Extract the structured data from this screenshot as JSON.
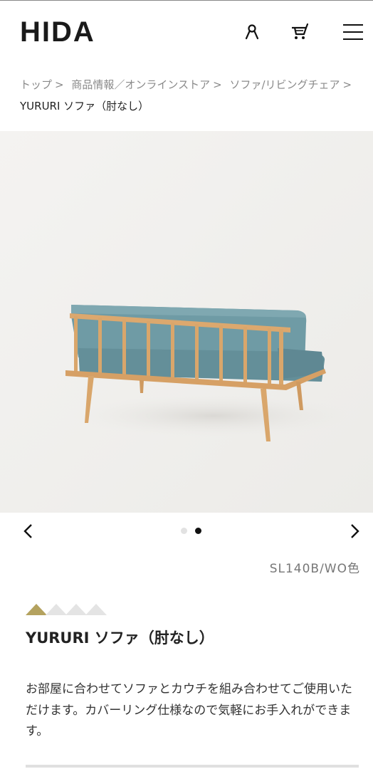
{
  "header": {
    "logo": "HIDA",
    "icons": [
      "user-icon",
      "cart-icon",
      "menu-icon"
    ]
  },
  "breadcrumb": {
    "items": [
      "トップ",
      "商品情報／オンラインストア",
      "ソファ/リビングチェア"
    ],
    "separator": ">",
    "current": "YURURI ソファ（肘なし）"
  },
  "gallery": {
    "image_alt": "sofa-photo",
    "slides": 2,
    "active_slide": 2
  },
  "product": {
    "variant": "SL140B/WO色",
    "rating": {
      "filled": 1,
      "total": 4
    },
    "name": "YURURI ソファ（肘なし）",
    "description": "お部屋に合わせてソファとカウチを組み合わせてご使用いただけます。カバーリング仕様なので気軽にお手入れができます。"
  },
  "colors": {
    "accent": "#b4a25f",
    "fabric": "#6f9ba5",
    "wood": "#d9a66b",
    "background": "#f1f0ee"
  }
}
